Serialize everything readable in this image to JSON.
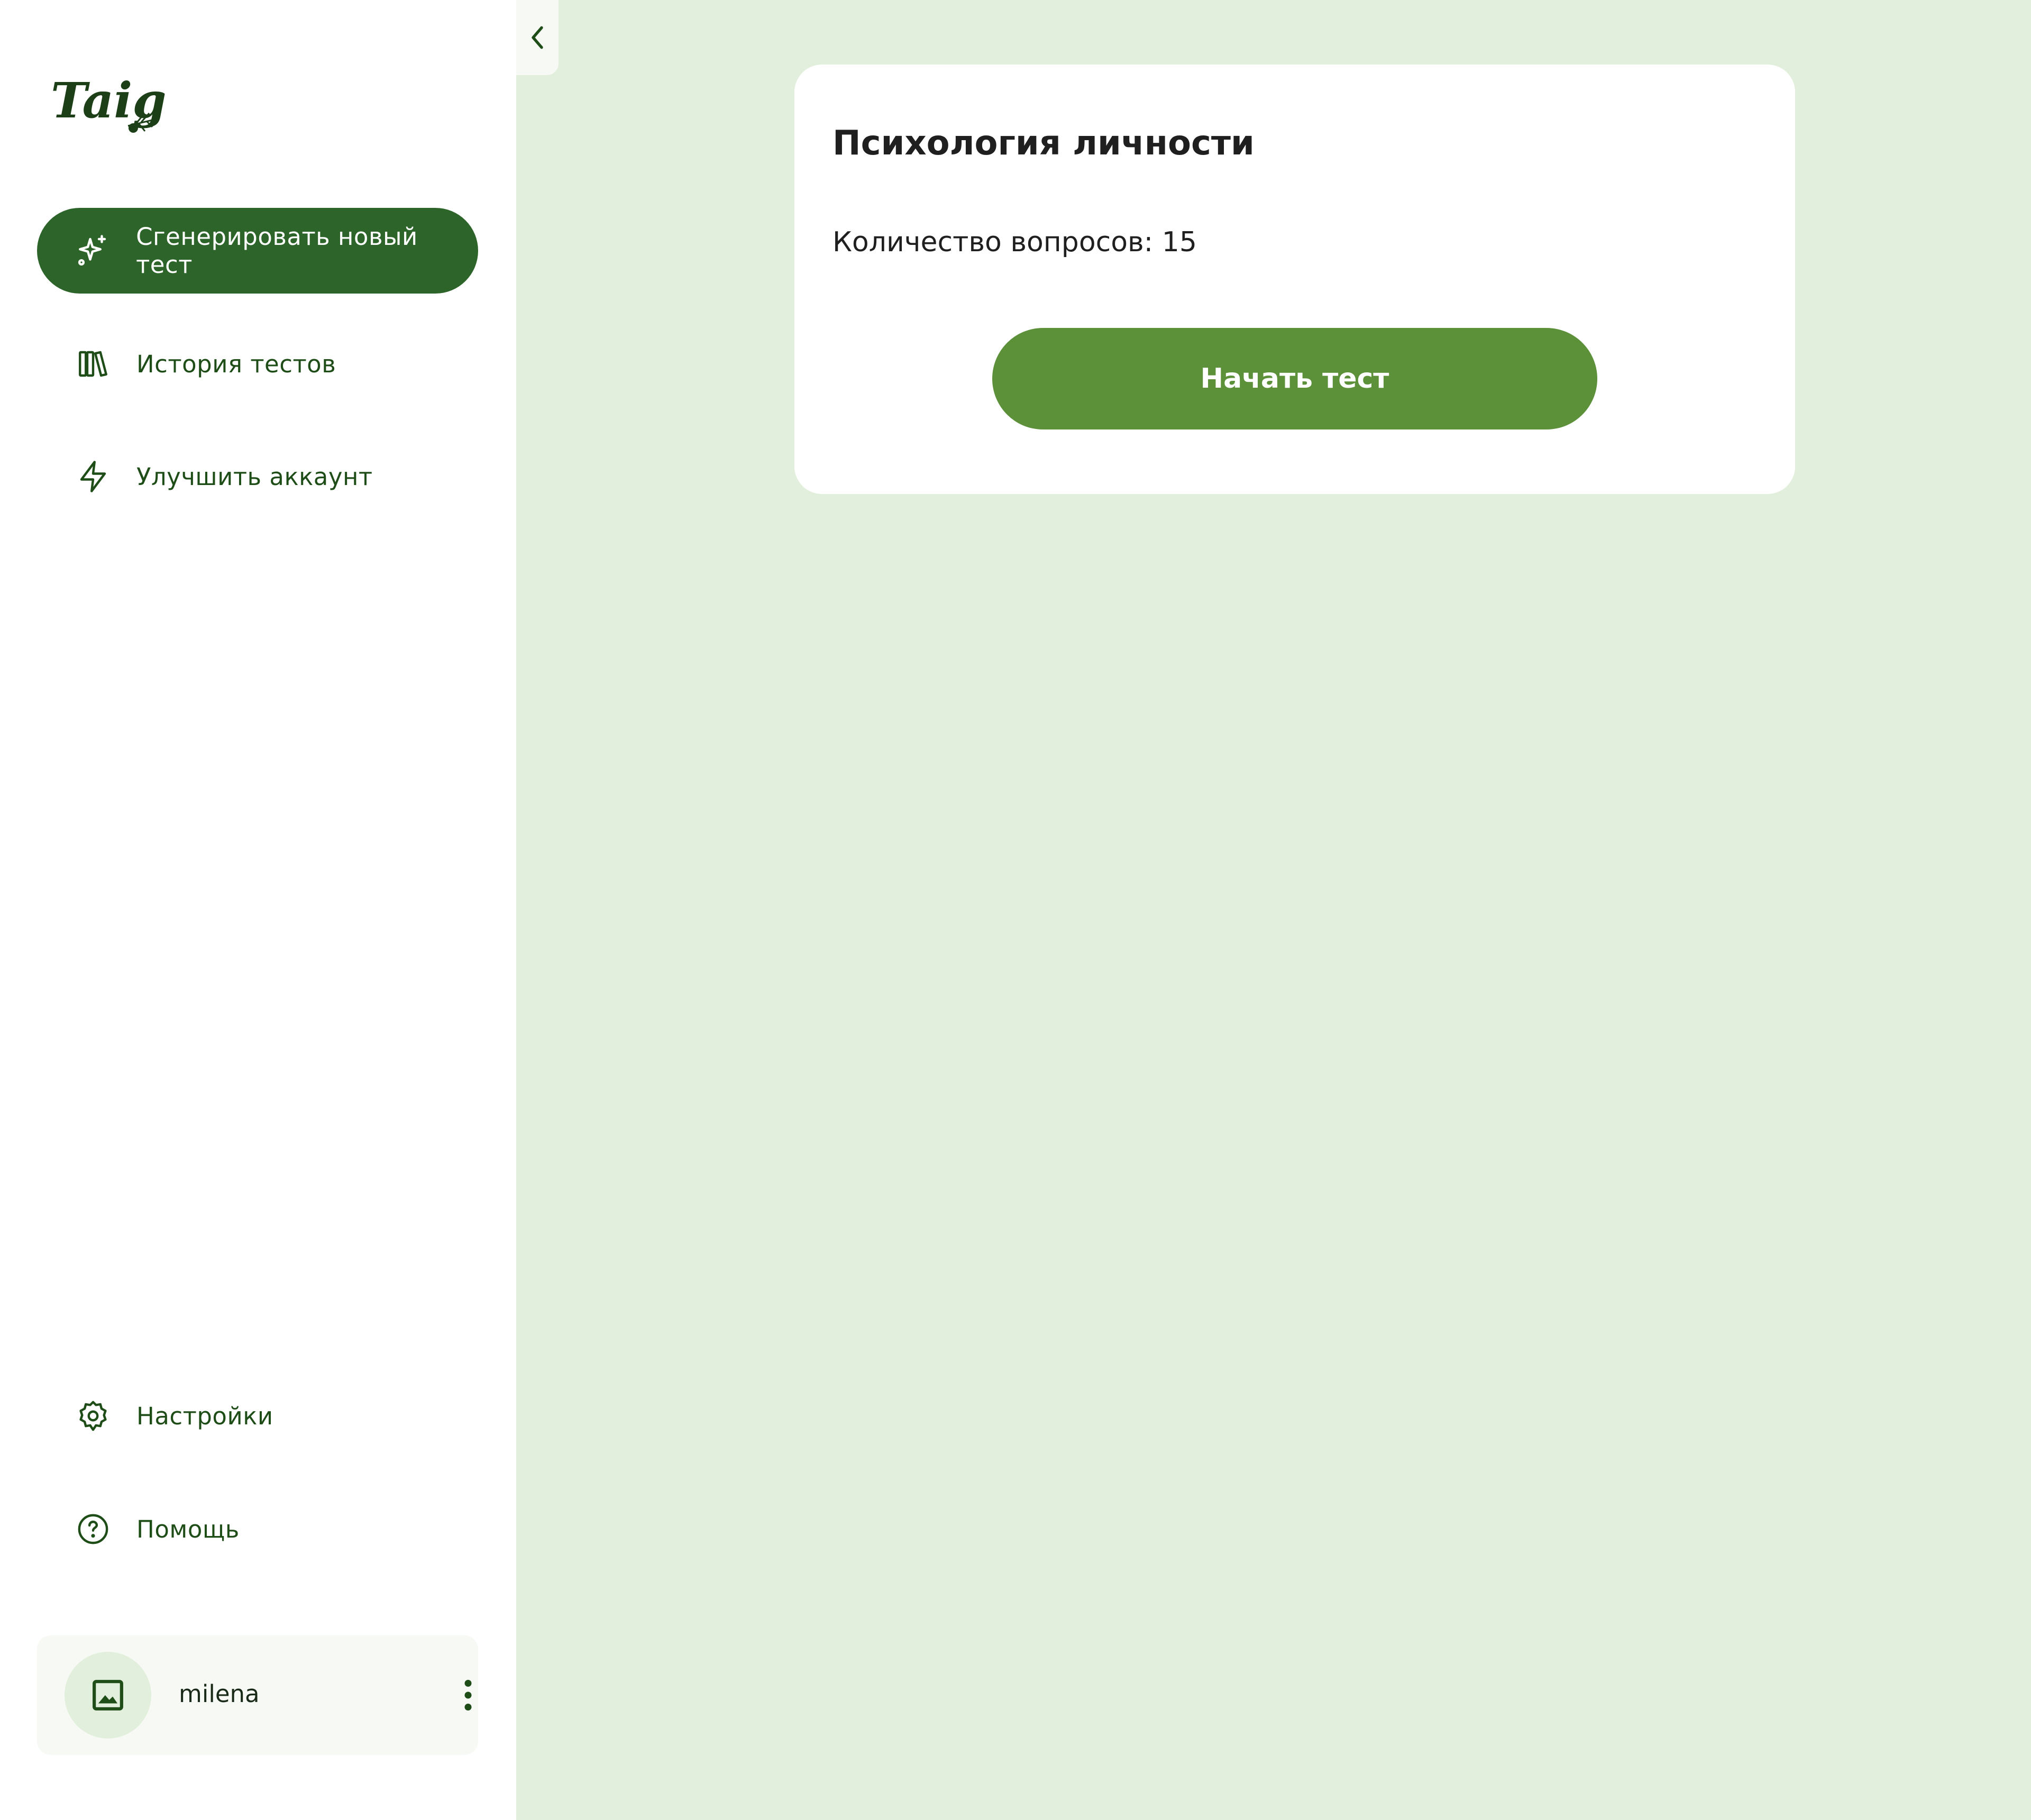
{
  "brand": {
    "logo_text": "Taiga"
  },
  "colors": {
    "primary_dark": "#2d6429",
    "primary": "#5c913a",
    "text_green": "#1e4d18",
    "background": "#e2efdc",
    "card": "#ffffff"
  },
  "sidebar": {
    "items": [
      {
        "label": "Сгенерировать новый тест",
        "icon": "sparkles-icon",
        "active": true
      },
      {
        "label": "История тестов",
        "icon": "library-icon",
        "active": false
      },
      {
        "label": "Улучшить аккаунт",
        "icon": "lightning-icon",
        "active": false
      }
    ],
    "bottom_items": [
      {
        "label": "Настройки",
        "icon": "gear-icon"
      },
      {
        "label": "Помощь",
        "icon": "help-circle-icon"
      }
    ],
    "user": {
      "name": "milena",
      "avatar_icon": "image-placeholder-icon",
      "menu_icon": "more-vertical-icon"
    },
    "collapse_icon": "chevron-left-icon"
  },
  "main": {
    "card": {
      "title": "Психология личности",
      "question_count_text": "Количество вопросов: 15",
      "start_button_label": "Начать тест"
    }
  }
}
